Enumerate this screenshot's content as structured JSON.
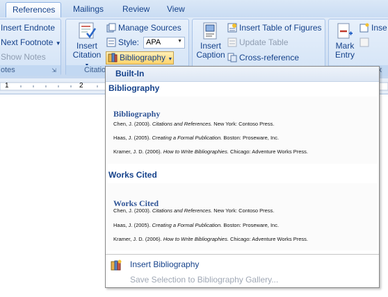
{
  "tabs": [
    {
      "label": "References",
      "active": true
    },
    {
      "label": "Mailings",
      "active": false
    },
    {
      "label": "Review",
      "active": false
    },
    {
      "label": "View",
      "active": false
    }
  ],
  "footnotes": {
    "insert_endnote": "Insert Endnote",
    "next_footnote": "Next Footnote",
    "show_notes": "Show Notes",
    "group_label": "otes"
  },
  "citations": {
    "insert_citation_line1": "Insert",
    "insert_citation_line2": "Citation",
    "manage_sources": "Manage Sources",
    "style_label": "Style:",
    "style_value": "APA",
    "bibliography": "Bibliography",
    "group_label": "Citatio"
  },
  "captions": {
    "insert_caption_line1": "Insert",
    "insert_caption_line2": "Caption",
    "insert_table_of_figures": "Insert Table of Figures",
    "update_table": "Update Table",
    "cross_reference": "Cross-reference"
  },
  "index": {
    "mark_entry_line1": "Mark",
    "mark_entry_line2": "Entry",
    "insert_index_partial": "Inse",
    "partial_group_label": "ex"
  },
  "ruler": {
    "marks": [
      "1",
      "2"
    ]
  },
  "dropdown": {
    "section_header": "Built-In",
    "galleries": [
      {
        "name": "Bibliography",
        "title": "Bibliography",
        "entries": [
          {
            "author": "Chen, J. (2003). ",
            "work": "Citations and References.",
            "publisher": " New York: Contoso Press."
          },
          {
            "author": "Haas, J. (2005). ",
            "work": "Creating a Formal Publication.",
            "publisher": " Boston: Proseware, Inc."
          },
          {
            "author": "Kramer, J. D. (2006). ",
            "work": "How to Write Bibliographies.",
            "publisher": " Chicago: Adventure Works Press."
          }
        ]
      },
      {
        "name": "Works Cited",
        "title": "Works Cited",
        "entries": [
          {
            "author": "Chen, J. (2003). ",
            "work": "Citations and References.",
            "publisher": " New York: Contoso Press."
          },
          {
            "author": "Haas, J. (2005). ",
            "work": "Creating a Formal Publication.",
            "publisher": " Boston: Proseware, Inc."
          },
          {
            "author": "Kramer, J. D. (2006). ",
            "work": "How to Write Bibliographies.",
            "publisher": " Chicago: Adventure Works Press."
          }
        ]
      }
    ],
    "insert_bibliography": "Insert Bibliography",
    "save_selection": "Save Selection to Bibliography Gallery..."
  },
  "colors": {
    "accent": "#15428b",
    "ribbon": "#d2e1f4",
    "highlight": "#ffd36b"
  },
  "icons": [
    "footnote-icon",
    "insert-citation-icon",
    "manage-sources-icon",
    "style-dropdown-icon",
    "bibliography-icon",
    "insert-caption-icon",
    "table-of-figures-icon",
    "update-table-icon",
    "cross-reference-icon",
    "mark-entry-icon",
    "insert-bibliography-icon"
  ]
}
